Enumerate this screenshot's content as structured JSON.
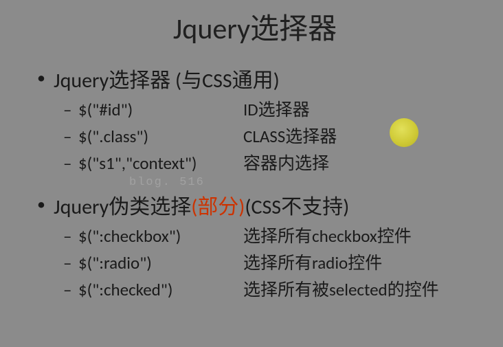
{
  "title": "Jquery选择器",
  "section1": {
    "heading": "Jquery选择器 (与CSS通用)",
    "items": [
      {
        "code": "$(\"#id\")",
        "desc": "ID选择器"
      },
      {
        "code": "$(\".class\")",
        "desc": "CLASS选择器"
      },
      {
        "code": "$(\"s1\",\"context\")",
        "desc": "容器内选择"
      }
    ]
  },
  "section2": {
    "heading_pre": "Jquery伪类选择",
    "heading_red": "(部分)",
    "heading_post": "(CSS不支持)",
    "items": [
      {
        "code": "$(\":checkbox\")",
        "desc": "选择所有checkbox控件"
      },
      {
        "code": "$(\":radio\")",
        "desc": "选择所有radio控件"
      },
      {
        "code": "$(\":checked\")",
        "desc": "选择所有被selected的控件"
      }
    ]
  },
  "watermark": "blog.        516"
}
